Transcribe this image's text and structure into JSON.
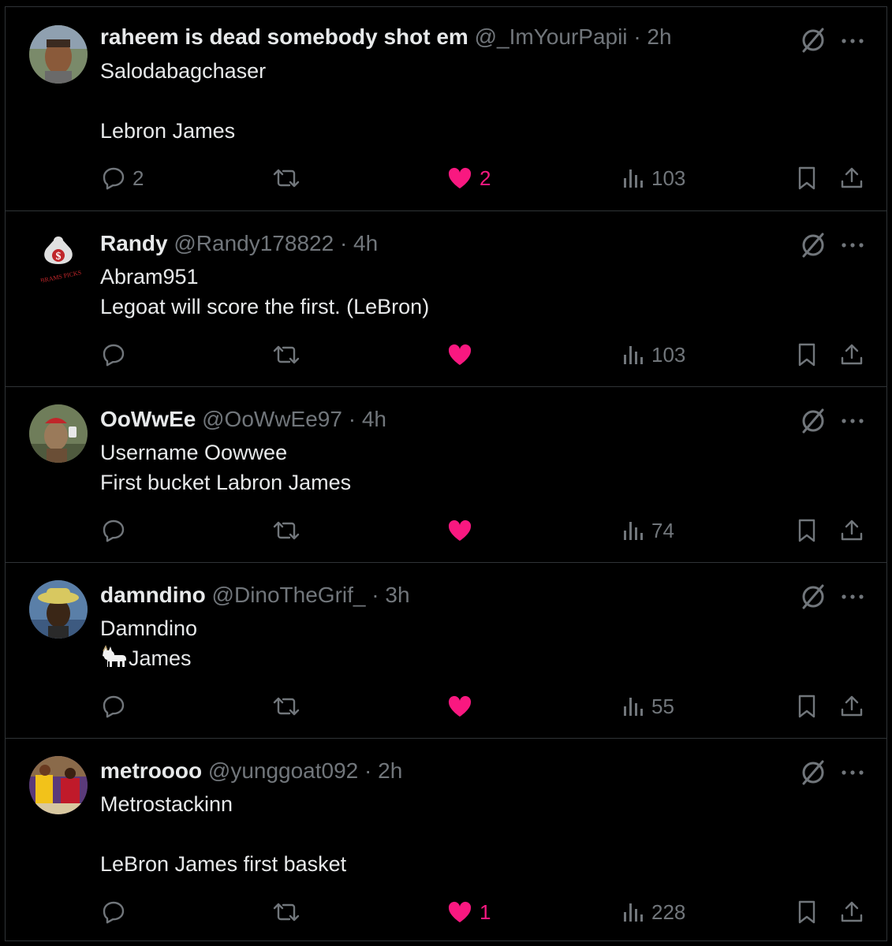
{
  "colors": {
    "background": "#000000",
    "text": "#e7e9ea",
    "muted": "#71767b",
    "like": "#f91880",
    "divider": "#2f3336"
  },
  "icons": {
    "reply": "reply-icon",
    "retweet": "retweet-icon",
    "like": "heart-icon",
    "views": "views-icon",
    "bookmark": "bookmark-icon",
    "share": "share-icon",
    "grok": "grok-icon",
    "more": "more-icon"
  },
  "tweets": [
    {
      "name": "raheem is dead somebody shot em",
      "handle": "@_ImYourPapii",
      "dot": "·",
      "time": "2h",
      "line1": "Salodabagchaser",
      "line2": "",
      "line3": "Lebron James",
      "replies": "2",
      "retweets": "",
      "likes": "2",
      "views": "103"
    },
    {
      "name": "Randy",
      "handle": "@Randy178822",
      "dot": "·",
      "time": "4h",
      "line1": "Abram951",
      "line2": "Legoat will score the first. (LeBron)",
      "line3": "",
      "replies": "",
      "retweets": "",
      "likes": "",
      "views": "103",
      "avatar_text": "ABRAMS PICKS"
    },
    {
      "name": "OoWwEe",
      "handle": "@OoWwEe97",
      "dot": "·",
      "time": "4h",
      "line1": "Username Oowwee",
      "line2": "First bucket Labron James",
      "line3": "",
      "replies": "",
      "retweets": "",
      "likes": "",
      "views": "74"
    },
    {
      "name": "damndino",
      "handle": "@DinoTheGrif_",
      "dot": "·",
      "time": "3h",
      "line1": "Damndino",
      "line2": "James",
      "line3": "",
      "replies": "",
      "retweets": "",
      "likes": "",
      "views": "55"
    },
    {
      "name": "metroooo",
      "handle": "@yunggoat092",
      "dot": "·",
      "time": "2h",
      "line1": "Metrostackinn",
      "line2": "",
      "line3": "LeBron James first basket",
      "replies": "",
      "retweets": "",
      "likes": "1",
      "views": "228"
    }
  ]
}
